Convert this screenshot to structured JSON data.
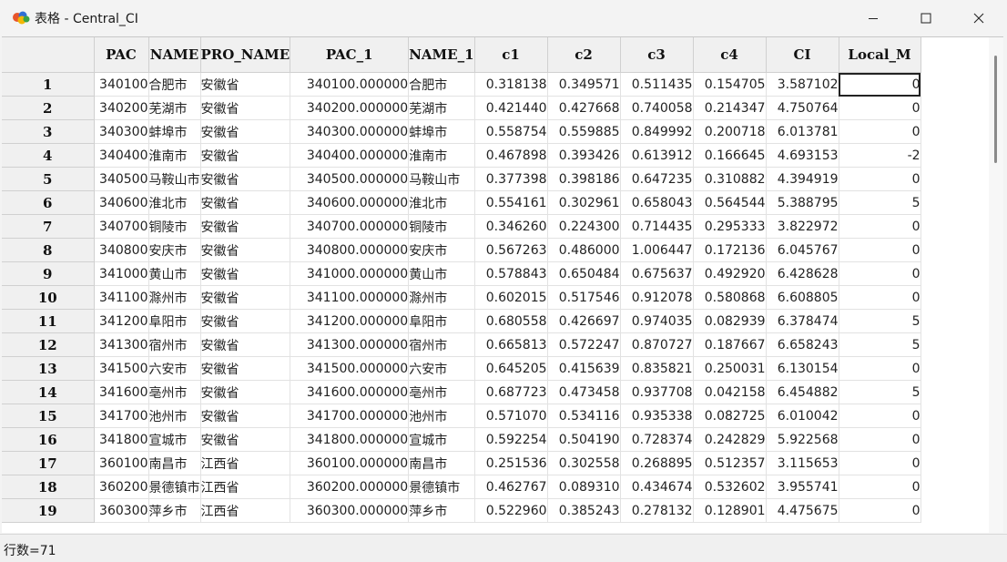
{
  "window": {
    "title": "表格 - Central_CI",
    "icons": [
      "app-map-icon",
      "minimize-icon",
      "maximize-icon",
      "close-icon"
    ]
  },
  "table": {
    "columns": [
      "PAC",
      "NAME",
      "PRO_NAME",
      "PAC_1",
      "NAME_1",
      "c1",
      "c2",
      "c3",
      "c4",
      "CI",
      "Local_M"
    ],
    "rows": [
      {
        "num": "1",
        "pac": "340100",
        "name": "合肥市",
        "pro": "安徽省",
        "pac1": "340100.000000",
        "name1": "合肥市",
        "c1": "0.318138",
        "c2": "0.349571",
        "c3": "0.511435",
        "c4": "0.154705",
        "ci": "3.587102",
        "local": "0"
      },
      {
        "num": "2",
        "pac": "340200",
        "name": "芜湖市",
        "pro": "安徽省",
        "pac1": "340200.000000",
        "name1": "芜湖市",
        "c1": "0.421440",
        "c2": "0.427668",
        "c3": "0.740058",
        "c4": "0.214347",
        "ci": "4.750764",
        "local": "0"
      },
      {
        "num": "3",
        "pac": "340300",
        "name": "蚌埠市",
        "pro": "安徽省",
        "pac1": "340300.000000",
        "name1": "蚌埠市",
        "c1": "0.558754",
        "c2": "0.559885",
        "c3": "0.849992",
        "c4": "0.200718",
        "ci": "6.013781",
        "local": "0"
      },
      {
        "num": "4",
        "pac": "340400",
        "name": "淮南市",
        "pro": "安徽省",
        "pac1": "340400.000000",
        "name1": "淮南市",
        "c1": "0.467898",
        "c2": "0.393426",
        "c3": "0.613912",
        "c4": "0.166645",
        "ci": "4.693153",
        "local": "-2"
      },
      {
        "num": "5",
        "pac": "340500",
        "name": "马鞍山市",
        "pro": "安徽省",
        "pac1": "340500.000000",
        "name1": "马鞍山市",
        "c1": "0.377398",
        "c2": "0.398186",
        "c3": "0.647235",
        "c4": "0.310882",
        "ci": "4.394919",
        "local": "0"
      },
      {
        "num": "6",
        "pac": "340600",
        "name": "淮北市",
        "pro": "安徽省",
        "pac1": "340600.000000",
        "name1": "淮北市",
        "c1": "0.554161",
        "c2": "0.302961",
        "c3": "0.658043",
        "c4": "0.564544",
        "ci": "5.388795",
        "local": "5"
      },
      {
        "num": "7",
        "pac": "340700",
        "name": "铜陵市",
        "pro": "安徽省",
        "pac1": "340700.000000",
        "name1": "铜陵市",
        "c1": "0.346260",
        "c2": "0.224300",
        "c3": "0.714435",
        "c4": "0.295333",
        "ci": "3.822972",
        "local": "0"
      },
      {
        "num": "8",
        "pac": "340800",
        "name": "安庆市",
        "pro": "安徽省",
        "pac1": "340800.000000",
        "name1": "安庆市",
        "c1": "0.567263",
        "c2": "0.486000",
        "c3": "1.006447",
        "c4": "0.172136",
        "ci": "6.045767",
        "local": "0"
      },
      {
        "num": "9",
        "pac": "341000",
        "name": "黄山市",
        "pro": "安徽省",
        "pac1": "341000.000000",
        "name1": "黄山市",
        "c1": "0.578843",
        "c2": "0.650484",
        "c3": "0.675637",
        "c4": "0.492920",
        "ci": "6.428628",
        "local": "0"
      },
      {
        "num": "10",
        "pac": "341100",
        "name": "滁州市",
        "pro": "安徽省",
        "pac1": "341100.000000",
        "name1": "滁州市",
        "c1": "0.602015",
        "c2": "0.517546",
        "c3": "0.912078",
        "c4": "0.580868",
        "ci": "6.608805",
        "local": "0"
      },
      {
        "num": "11",
        "pac": "341200",
        "name": "阜阳市",
        "pro": "安徽省",
        "pac1": "341200.000000",
        "name1": "阜阳市",
        "c1": "0.680558",
        "c2": "0.426697",
        "c3": "0.974035",
        "c4": "0.082939",
        "ci": "6.378474",
        "local": "5"
      },
      {
        "num": "12",
        "pac": "341300",
        "name": "宿州市",
        "pro": "安徽省",
        "pac1": "341300.000000",
        "name1": "宿州市",
        "c1": "0.665813",
        "c2": "0.572247",
        "c3": "0.870727",
        "c4": "0.187667",
        "ci": "6.658243",
        "local": "5"
      },
      {
        "num": "13",
        "pac": "341500",
        "name": "六安市",
        "pro": "安徽省",
        "pac1": "341500.000000",
        "name1": "六安市",
        "c1": "0.645205",
        "c2": "0.415639",
        "c3": "0.835821",
        "c4": "0.250031",
        "ci": "6.130154",
        "local": "0"
      },
      {
        "num": "14",
        "pac": "341600",
        "name": "亳州市",
        "pro": "安徽省",
        "pac1": "341600.000000",
        "name1": "亳州市",
        "c1": "0.687723",
        "c2": "0.473458",
        "c3": "0.937708",
        "c4": "0.042158",
        "ci": "6.454882",
        "local": "5"
      },
      {
        "num": "15",
        "pac": "341700",
        "name": "池州市",
        "pro": "安徽省",
        "pac1": "341700.000000",
        "name1": "池州市",
        "c1": "0.571070",
        "c2": "0.534116",
        "c3": "0.935338",
        "c4": "0.082725",
        "ci": "6.010042",
        "local": "0"
      },
      {
        "num": "16",
        "pac": "341800",
        "name": "宣城市",
        "pro": "安徽省",
        "pac1": "341800.000000",
        "name1": "宣城市",
        "c1": "0.592254",
        "c2": "0.504190",
        "c3": "0.728374",
        "c4": "0.242829",
        "ci": "5.922568",
        "local": "0"
      },
      {
        "num": "17",
        "pac": "360100",
        "name": "南昌市",
        "pro": "江西省",
        "pac1": "360100.000000",
        "name1": "南昌市",
        "c1": "0.251536",
        "c2": "0.302558",
        "c3": "0.268895",
        "c4": "0.512357",
        "ci": "3.115653",
        "local": "0"
      },
      {
        "num": "18",
        "pac": "360200",
        "name": "景德镇市",
        "pro": "江西省",
        "pac1": "360200.000000",
        "name1": "景德镇市",
        "c1": "0.462767",
        "c2": "0.089310",
        "c3": "0.434674",
        "c4": "0.532602",
        "ci": "3.955741",
        "local": "0"
      },
      {
        "num": "19",
        "pac": "360300",
        "name": "萍乡市",
        "pro": "江西省",
        "pac1": "360300.000000",
        "name1": "萍乡市",
        "c1": "0.522960",
        "c2": "0.385243",
        "c3": "0.278132",
        "c4": "0.128901",
        "ci": "4.475675",
        "local": "0"
      }
    ]
  },
  "status": {
    "row_count": "行数=71"
  }
}
